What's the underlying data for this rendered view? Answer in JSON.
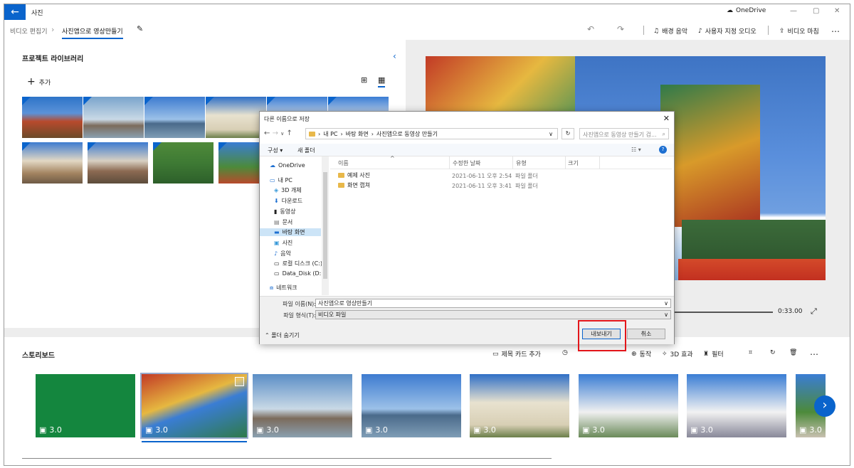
{
  "app": {
    "back_icon": "←",
    "title": "사진",
    "onedrive": "OneDrive",
    "window_controls": [
      "—",
      "▢",
      "✕"
    ]
  },
  "toolbar": {
    "crumb_parent": "비디오 편집기",
    "crumb_current": "사진앱으로 영상만들기",
    "edit_icon": "✎",
    "undo_icon": "↶",
    "redo_icon": "↷",
    "music": "배경 음악",
    "custom_audio": "사용자 지정 오디오",
    "finish": "비디오 마침",
    "more": "⋯"
  },
  "library": {
    "title": "프로젝트 라이브러리",
    "add": "추가",
    "chev": "‹"
  },
  "player": {
    "time": "0:33.00"
  },
  "storyboard": {
    "title": "스토리보드",
    "tools": {
      "title_card": "제목 카드 추가",
      "motion": "동작",
      "effects_3d": "3D 효과",
      "filters": "필터"
    },
    "durations": [
      "3.0",
      "3.0",
      "3.0",
      "3.0",
      "3.0",
      "3.0",
      "3.0",
      "3.0"
    ],
    "next_icon": "›"
  },
  "dialog": {
    "title": "다른 이름으로 저장",
    "close": "✕",
    "path": [
      "내 PC",
      "바탕 화면",
      "사진앱으로 동영상 만들기"
    ],
    "search_placeholder": "사진앱으로 동영상 만들기 검...",
    "organize": "구성 ▾",
    "new_folder": "새 폴더",
    "help": "?",
    "tree": [
      "OneDrive",
      "내 PC",
      "3D 개체",
      "다운로드",
      "동영상",
      "문서",
      "바탕 화면",
      "사진",
      "음악",
      "로컬 디스크 (C:)",
      "Data_Disk (D:)",
      "네트워크"
    ],
    "columns": [
      "이름",
      "수정한 날짜",
      "유형",
      "크기"
    ],
    "files": [
      {
        "name": "예제 사진",
        "date": "2021-06-11 오후 2:54",
        "type": "파일 폴더"
      },
      {
        "name": "화면 캡쳐",
        "date": "2021-06-11 오후 3:41",
        "type": "파일 폴더"
      }
    ],
    "filename_label": "파일 이름(N):",
    "filename": "사진앱으로 영상만들기",
    "filetype_label": "파일 형식(T):",
    "filetype": "비디오 파일",
    "hide_folders": "폴더 숨기기",
    "export": "내보내기",
    "cancel": "취소"
  },
  "colors": {
    "accent": "#0a64cc",
    "highlight": "#e3151a"
  }
}
